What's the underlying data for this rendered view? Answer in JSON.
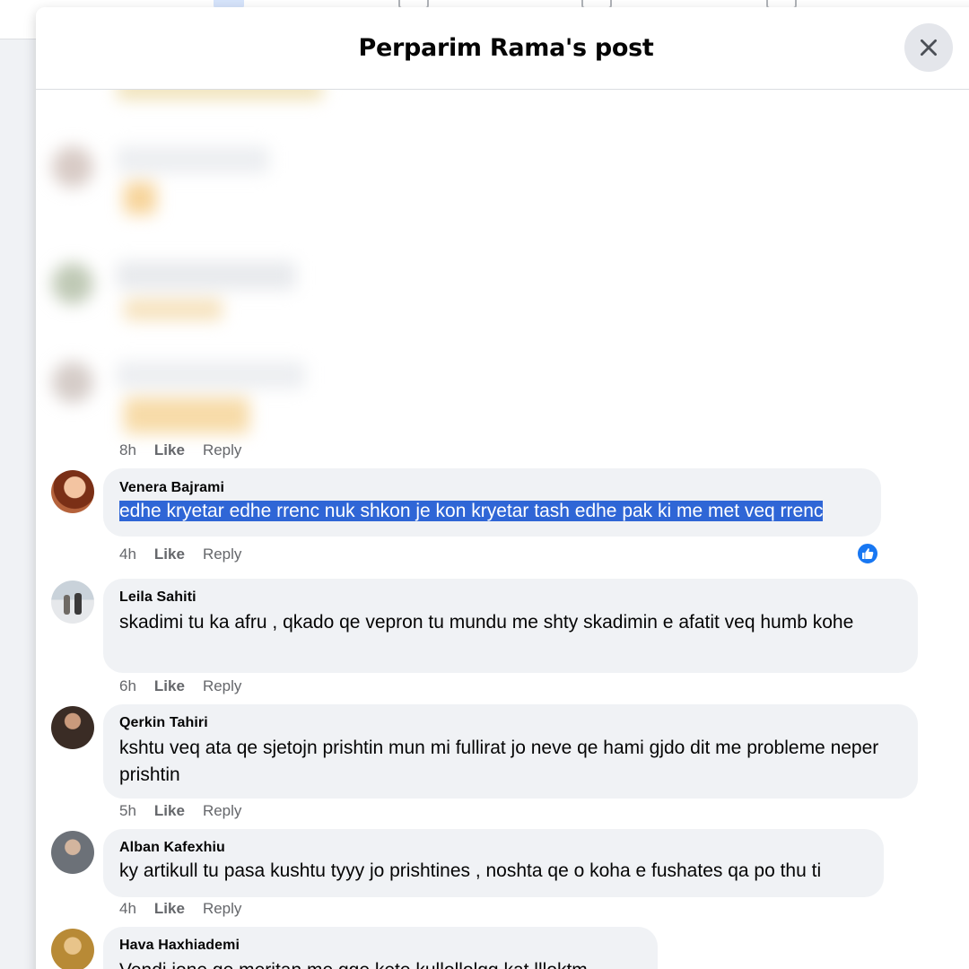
{
  "dialog": {
    "title": "Perparim Rama's post",
    "close_label": "Close"
  },
  "first_meta": {
    "time": "8h",
    "like": "Like",
    "reply": "Reply"
  },
  "comments": [
    {
      "author": "Venera Bajrami",
      "text": "edhe kryetar edhe rrenc nuk shkon je kon kryetar tash edhe pak ki me met veq rrenc",
      "selected": true,
      "time": "4h",
      "like": "Like",
      "reply": "Reply",
      "reaction_icon": "thumbs-up-icon",
      "avatar_color": "#b5623b"
    },
    {
      "author": "Leila Sahiti",
      "text": "skadimi tu ka afru , qkado qe vepron tu mundu me shty skadimin e afatit veq humb kohe",
      "time": "6h",
      "like": "Like",
      "reply": "Reply",
      "avatar_color": "#9aa4ad"
    },
    {
      "author": "Qerkin Tahiri",
      "text": "kshtu veq ata qe sjetojn prishtin mun mi fullirat jo neve qe hami gjdo dit me probleme neper prishtin",
      "time": "5h",
      "like": "Like",
      "reply": "Reply",
      "avatar_color": "#4a3a32"
    },
    {
      "author": "Alban Kafexhiu",
      "text": "ky artikull tu pasa kushtu tyyy jo prishtines , noshta qe o koha e fushates qa po thu ti",
      "time": "4h",
      "like": "Like",
      "reply": "Reply",
      "avatar_color": "#5b5f66"
    },
    {
      "author": "Hava Haxhiademi",
      "text": "Vendi jone ge meritan me gge kete kullollolgg kat llloktm",
      "time": "",
      "like": "",
      "reply": "",
      "avatar_color": "#c9a04c"
    }
  ],
  "colors": {
    "selection": "#2f66d6",
    "bubble": "#f0f2f5",
    "like_badge": "#1877f2"
  }
}
